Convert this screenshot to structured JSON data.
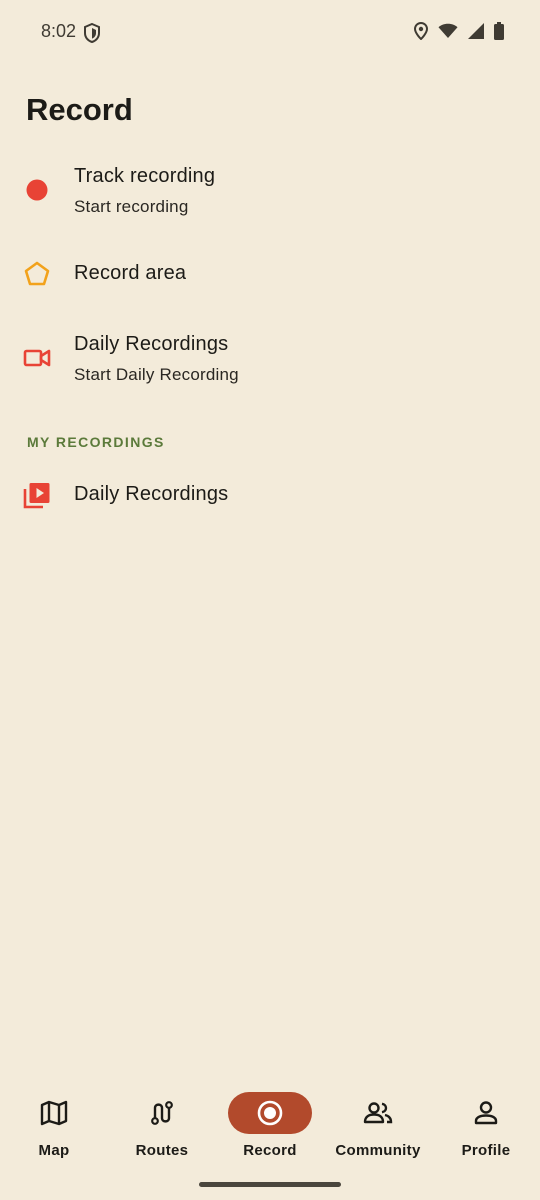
{
  "status_bar": {
    "time": "8:02",
    "icons": [
      "shield-icon",
      "location-icon",
      "wifi-icon",
      "cell-signal-icon",
      "battery-icon"
    ]
  },
  "page": {
    "title": "Record"
  },
  "menu": {
    "items": [
      {
        "title": "Track recording",
        "subtitle": "Start recording",
        "icon": "red-dot-icon",
        "icon_color": "#e84335"
      },
      {
        "title": "Record area",
        "subtitle": "",
        "icon": "pentagon-icon",
        "icon_color": "#f2a21b"
      },
      {
        "title": "Daily Recordings",
        "subtitle": "Start Daily Recording",
        "icon": "videocam-icon",
        "icon_color": "#e84335"
      }
    ]
  },
  "my_recordings": {
    "header": "MY RECORDINGS",
    "items": [
      {
        "title": "Daily Recordings",
        "icon": "video-library-icon",
        "icon_color": "#e84335"
      }
    ]
  },
  "bottom_nav": {
    "active": "Record",
    "accent": "#b24a2c",
    "items": [
      {
        "label": "Map",
        "icon": "map-icon"
      },
      {
        "label": "Routes",
        "icon": "routes-icon"
      },
      {
        "label": "Record",
        "icon": "record-icon"
      },
      {
        "label": "Community",
        "icon": "community-icon"
      },
      {
        "label": "Profile",
        "icon": "profile-icon"
      }
    ]
  }
}
